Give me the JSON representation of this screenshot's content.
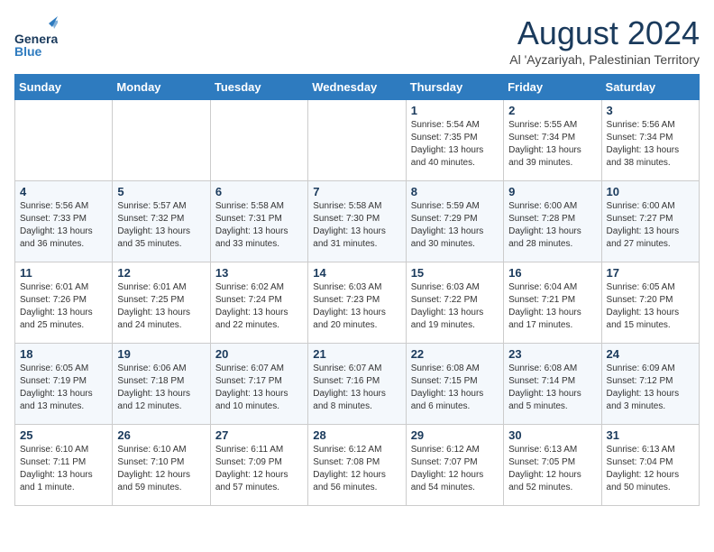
{
  "header": {
    "logo_line1": "General",
    "logo_line2": "Blue",
    "month": "August 2024",
    "location": "Al 'Ayzariyah, Palestinian Territory"
  },
  "weekdays": [
    "Sunday",
    "Monday",
    "Tuesday",
    "Wednesday",
    "Thursday",
    "Friday",
    "Saturday"
  ],
  "weeks": [
    [
      {
        "day": "",
        "info": ""
      },
      {
        "day": "",
        "info": ""
      },
      {
        "day": "",
        "info": ""
      },
      {
        "day": "",
        "info": ""
      },
      {
        "day": "1",
        "info": "Sunrise: 5:54 AM\nSunset: 7:35 PM\nDaylight: 13 hours\nand 40 minutes."
      },
      {
        "day": "2",
        "info": "Sunrise: 5:55 AM\nSunset: 7:34 PM\nDaylight: 13 hours\nand 39 minutes."
      },
      {
        "day": "3",
        "info": "Sunrise: 5:56 AM\nSunset: 7:34 PM\nDaylight: 13 hours\nand 38 minutes."
      }
    ],
    [
      {
        "day": "4",
        "info": "Sunrise: 5:56 AM\nSunset: 7:33 PM\nDaylight: 13 hours\nand 36 minutes."
      },
      {
        "day": "5",
        "info": "Sunrise: 5:57 AM\nSunset: 7:32 PM\nDaylight: 13 hours\nand 35 minutes."
      },
      {
        "day": "6",
        "info": "Sunrise: 5:58 AM\nSunset: 7:31 PM\nDaylight: 13 hours\nand 33 minutes."
      },
      {
        "day": "7",
        "info": "Sunrise: 5:58 AM\nSunset: 7:30 PM\nDaylight: 13 hours\nand 31 minutes."
      },
      {
        "day": "8",
        "info": "Sunrise: 5:59 AM\nSunset: 7:29 PM\nDaylight: 13 hours\nand 30 minutes."
      },
      {
        "day": "9",
        "info": "Sunrise: 6:00 AM\nSunset: 7:28 PM\nDaylight: 13 hours\nand 28 minutes."
      },
      {
        "day": "10",
        "info": "Sunrise: 6:00 AM\nSunset: 7:27 PM\nDaylight: 13 hours\nand 27 minutes."
      }
    ],
    [
      {
        "day": "11",
        "info": "Sunrise: 6:01 AM\nSunset: 7:26 PM\nDaylight: 13 hours\nand 25 minutes."
      },
      {
        "day": "12",
        "info": "Sunrise: 6:01 AM\nSunset: 7:25 PM\nDaylight: 13 hours\nand 24 minutes."
      },
      {
        "day": "13",
        "info": "Sunrise: 6:02 AM\nSunset: 7:24 PM\nDaylight: 13 hours\nand 22 minutes."
      },
      {
        "day": "14",
        "info": "Sunrise: 6:03 AM\nSunset: 7:23 PM\nDaylight: 13 hours\nand 20 minutes."
      },
      {
        "day": "15",
        "info": "Sunrise: 6:03 AM\nSunset: 7:22 PM\nDaylight: 13 hours\nand 19 minutes."
      },
      {
        "day": "16",
        "info": "Sunrise: 6:04 AM\nSunset: 7:21 PM\nDaylight: 13 hours\nand 17 minutes."
      },
      {
        "day": "17",
        "info": "Sunrise: 6:05 AM\nSunset: 7:20 PM\nDaylight: 13 hours\nand 15 minutes."
      }
    ],
    [
      {
        "day": "18",
        "info": "Sunrise: 6:05 AM\nSunset: 7:19 PM\nDaylight: 13 hours\nand 13 minutes."
      },
      {
        "day": "19",
        "info": "Sunrise: 6:06 AM\nSunset: 7:18 PM\nDaylight: 13 hours\nand 12 minutes."
      },
      {
        "day": "20",
        "info": "Sunrise: 6:07 AM\nSunset: 7:17 PM\nDaylight: 13 hours\nand 10 minutes."
      },
      {
        "day": "21",
        "info": "Sunrise: 6:07 AM\nSunset: 7:16 PM\nDaylight: 13 hours\nand 8 minutes."
      },
      {
        "day": "22",
        "info": "Sunrise: 6:08 AM\nSunset: 7:15 PM\nDaylight: 13 hours\nand 6 minutes."
      },
      {
        "day": "23",
        "info": "Sunrise: 6:08 AM\nSunset: 7:14 PM\nDaylight: 13 hours\nand 5 minutes."
      },
      {
        "day": "24",
        "info": "Sunrise: 6:09 AM\nSunset: 7:12 PM\nDaylight: 13 hours\nand 3 minutes."
      }
    ],
    [
      {
        "day": "25",
        "info": "Sunrise: 6:10 AM\nSunset: 7:11 PM\nDaylight: 13 hours\nand 1 minute."
      },
      {
        "day": "26",
        "info": "Sunrise: 6:10 AM\nSunset: 7:10 PM\nDaylight: 12 hours\nand 59 minutes."
      },
      {
        "day": "27",
        "info": "Sunrise: 6:11 AM\nSunset: 7:09 PM\nDaylight: 12 hours\nand 57 minutes."
      },
      {
        "day": "28",
        "info": "Sunrise: 6:12 AM\nSunset: 7:08 PM\nDaylight: 12 hours\nand 56 minutes."
      },
      {
        "day": "29",
        "info": "Sunrise: 6:12 AM\nSunset: 7:07 PM\nDaylight: 12 hours\nand 54 minutes."
      },
      {
        "day": "30",
        "info": "Sunrise: 6:13 AM\nSunset: 7:05 PM\nDaylight: 12 hours\nand 52 minutes."
      },
      {
        "day": "31",
        "info": "Sunrise: 6:13 AM\nSunset: 7:04 PM\nDaylight: 12 hours\nand 50 minutes."
      }
    ]
  ]
}
